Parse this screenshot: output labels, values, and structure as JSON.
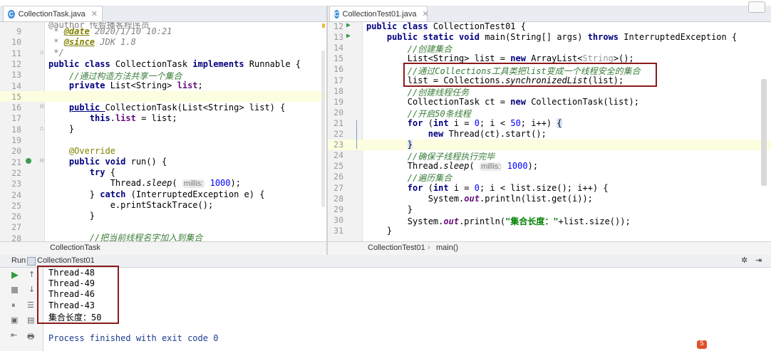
{
  "left_editor": {
    "tab": {
      "icon": "C",
      "label": "CollectionTask.java"
    },
    "breadcrumb": "CollectionTask",
    "lines": [
      {
        "n": "9"
      },
      {
        "n": "10"
      },
      {
        "n": "11"
      },
      {
        "n": "12"
      },
      {
        "n": "13"
      },
      {
        "n": "14"
      },
      {
        "n": "15"
      },
      {
        "n": "16"
      },
      {
        "n": "17"
      },
      {
        "n": "18"
      },
      {
        "n": "19"
      },
      {
        "n": "20"
      },
      {
        "n": "21"
      },
      {
        "n": "22"
      },
      {
        "n": "23"
      },
      {
        "n": "24"
      },
      {
        "n": "25"
      },
      {
        "n": "26"
      },
      {
        "n": "27"
      },
      {
        "n": "28"
      }
    ],
    "code": {
      "top_partial": "@author 传智播客程序员",
      "l9a": " * ",
      "l9b": "@date",
      "l9c": " 2020/1/10 10:21",
      "l10a": " * ",
      "l10b": "@since",
      "l10c": " JDK 1.8",
      "l11": " */",
      "l12a": "public class ",
      "l12b": "CollectionTask ",
      "l12c": "implements ",
      "l12d": "Runnable {",
      "l13": "    //通过构造方法共享一个集合",
      "l14a": "    ",
      "l14b": "private ",
      "l14c": "List<String> ",
      "l14d": "list",
      "l14e": ";",
      "l16a": "    ",
      "l16b": "public ",
      "l16c": "CollectionTask(List<String> list) {",
      "l17a": "        ",
      "l17b": "this",
      "l17c": ".",
      "l17d": "list",
      "l17e": " = list;",
      "l18": "    }",
      "l20": "    @Override",
      "l21a": "    ",
      "l21b": "public void ",
      "l21c": "run() {",
      "l22a": "        ",
      "l22b": "try",
      "l22c": " {",
      "l23a": "            Thread.",
      "l23b": "sleep",
      "l23c": "( ",
      "l23d": "millis:",
      "l23e": " ",
      "l23f": "1000",
      "l23g": ");",
      "l24a": "        } ",
      "l24b": "catch",
      "l24c": " (InterruptedException e) {",
      "l25": "            e.printStackTrace();",
      "l26": "        }",
      "l28": "        //把当前线程名字加入到集合"
    }
  },
  "right_editor": {
    "tab": {
      "icon": "C",
      "label": "CollectionTest01.java"
    },
    "breadcrumb_class": "CollectionTest01",
    "breadcrumb_sep": "›",
    "breadcrumb_method": "main()",
    "lines": [
      {
        "n": "12"
      },
      {
        "n": "13"
      },
      {
        "n": "14"
      },
      {
        "n": "15"
      },
      {
        "n": "16"
      },
      {
        "n": "17"
      },
      {
        "n": "18"
      },
      {
        "n": "19"
      },
      {
        "n": "20"
      },
      {
        "n": "21"
      },
      {
        "n": "22"
      },
      {
        "n": "23"
      },
      {
        "n": "24"
      },
      {
        "n": "25"
      },
      {
        "n": "26"
      },
      {
        "n": "27"
      },
      {
        "n": "28"
      },
      {
        "n": "29"
      },
      {
        "n": "30"
      },
      {
        "n": "31"
      }
    ],
    "code": {
      "r12a": "public class ",
      "r12b": "CollectionTest01 {",
      "r13a": "    ",
      "r13b": "public static void ",
      "r13c": "main(String[] args) ",
      "r13d": "throws ",
      "r13e": "InterruptedException {",
      "r14": "        //创建集合",
      "r15a": "        List<String> list = ",
      "r15b": "new ",
      "r15c": "ArrayList<",
      "r15d": "String",
      "r15e": ">();",
      "r16a": "        //通过",
      "r16b": "Collections",
      "r16c": "工具类把",
      "r16d": "list",
      "r16e": "变成一个线程安全的集合",
      "r17a": "        list = Collections.",
      "r17b": "synchronizedList",
      "r17c": "(list);",
      "r18": "        //创建线程任务",
      "r19a": "        CollectionTask ct = ",
      "r19b": "new ",
      "r19c": "CollectionTask(list);",
      "r20": "        //开启50条线程",
      "r21a": "        ",
      "r21b": "for ",
      "r21c": "(",
      "r21d": "int ",
      "r21e": "i = ",
      "r21f": "0",
      "r21g": "; i < ",
      "r21h": "50",
      "r21i": "; i++) ",
      "r21j": "{",
      "r22a": "            ",
      "r22b": "new ",
      "r22c": "Thread(ct).start();",
      "r23a": "        ",
      "r23b": "}",
      "r24": "        //确保子线程执行完毕",
      "r25a": "        Thread.",
      "r25b": "sleep",
      "r25c": "( ",
      "r25d": "millis:",
      "r25e": " ",
      "r25f": "1000",
      "r25g": ");",
      "r26": "        //遍历集合",
      "r27a": "        ",
      "r27b": "for ",
      "r27c": "(",
      "r27d": "int ",
      "r27e": "i = ",
      "r27f": "0",
      "r27g": "; i < list.size(); i++) {",
      "r28a": "            System.",
      "r28b": "out",
      "r28c": ".println(list.get(i));",
      "r29": "        }",
      "r30a": "        System.",
      "r30b": "out",
      "r30c": ".println(",
      "r30d": "\"集合长度：\"",
      "r30e": "+list.size());",
      "r31": "    }"
    }
  },
  "run_panel": {
    "label": "Run",
    "config": "CollectionTest01",
    "output": [
      "Thread-48",
      "Thread-49",
      "Thread-46",
      "Thread-43",
      "集合长度：50"
    ],
    "finished": "Process finished with exit code 0"
  },
  "colors": {
    "highlight_box": "#8b1a1a",
    "keyword": "#000080",
    "comment": "#808080",
    "run_green": "#2e9d3e"
  },
  "icons": [
    "class-file-icon",
    "close-icon",
    "run-icon",
    "stop-icon",
    "pause-icon",
    "gear-icon",
    "pin-icon",
    "up-arrow-icon",
    "down-arrow-icon"
  ]
}
